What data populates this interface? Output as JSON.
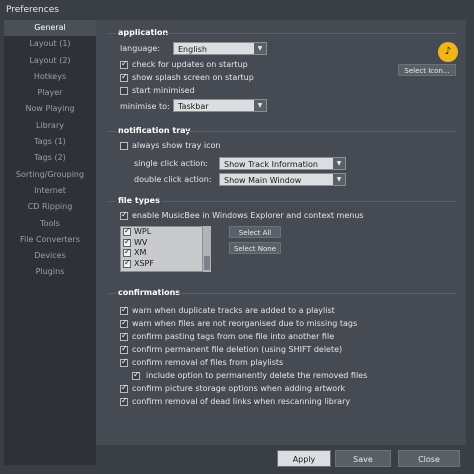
{
  "window": {
    "title": "Preferences"
  },
  "sidebar": {
    "items": [
      {
        "label": "General"
      },
      {
        "label": "Layout (1)"
      },
      {
        "label": "Layout (2)"
      },
      {
        "label": "Hotkeys"
      },
      {
        "label": "Player"
      },
      {
        "label": "Now Playing"
      },
      {
        "label": "Library"
      },
      {
        "label": "Tags (1)"
      },
      {
        "label": "Tags (2)"
      },
      {
        "label": "Sorting/Grouping"
      },
      {
        "label": "Internet"
      },
      {
        "label": "CD Ripping"
      },
      {
        "label": "Tools"
      },
      {
        "label": "File Converters"
      },
      {
        "label": "Devices"
      },
      {
        "label": "Plugins"
      }
    ]
  },
  "application": {
    "title": "application",
    "language_label": "language:",
    "language_value": "English",
    "check_updates": "check for updates on startup",
    "splash": "show splash screen on startup",
    "start_minimised": "start minimised",
    "minimise_label": "minimise to:",
    "minimise_value": "Taskbar",
    "select_icon": "Select Icon..."
  },
  "notification": {
    "title": "notification tray",
    "always_show": "always show tray icon",
    "single_label": "single click action:",
    "single_value": "Show Track Information",
    "double_label": "double click action:",
    "double_value": "Show Main Window"
  },
  "file_types": {
    "title": "file types",
    "enable": "enable MusicBee in Windows Explorer and context menus",
    "list": [
      "WPL",
      "WV",
      "XM",
      "XSPF"
    ],
    "select_all": "Select All",
    "select_none": "Select None"
  },
  "confirmations": {
    "title": "confirmations",
    "items": [
      "warn when duplicate tracks are added to a playlist",
      "warn when files are not reorganised due to missing tags",
      "confirm pasting tags from one file into another file",
      "confirm permanent file deletion (using SHIFT delete)",
      "confirm removal of files from playlists",
      "include option to permanently delete the removed files",
      "confirm picture storage options when adding artwork",
      "confirm removal of dead links when rescanning library"
    ]
  },
  "footer": {
    "apply": "Apply",
    "save": "Save",
    "close": "Close"
  },
  "icons": {
    "dropdown": "chevron-down-icon",
    "logo": "musicbee-logo-icon"
  }
}
